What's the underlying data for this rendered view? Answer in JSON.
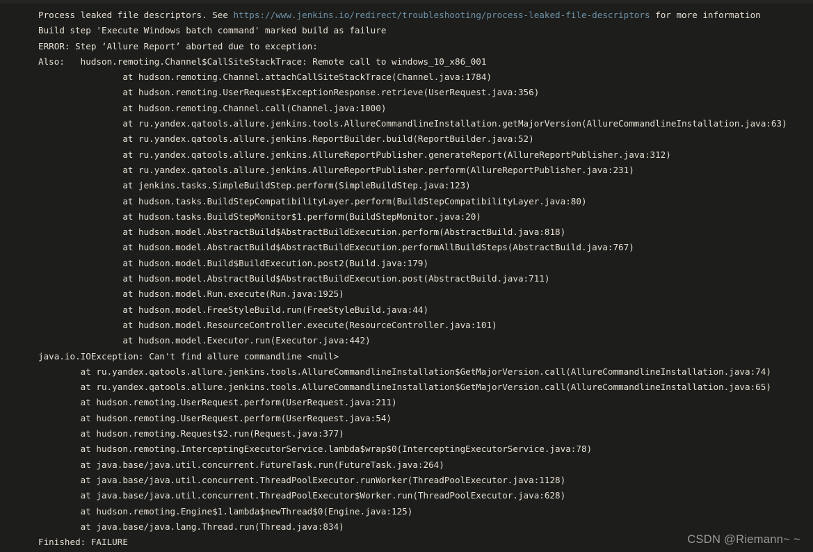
{
  "console": {
    "background_color": "#1d1d1b",
    "text_color": "#e6e0d4",
    "link_color": "#6f93a8",
    "lines": [
      {
        "pre": "Process leaked file descriptors. See ",
        "link": "https://www.jenkins.io/redirect/troubleshooting/process-leaked-file-descriptors",
        "post": " for more information"
      },
      {
        "text": "Build step 'Execute Windows batch command' marked build as failure"
      },
      {
        "text": "ERROR: Step ‘Allure Report’ aborted due to exception:"
      },
      {
        "text": "Also:   hudson.remoting.Channel$CallSiteStackTrace: Remote call to windows_10_x86_001"
      },
      {
        "text": "                at hudson.remoting.Channel.attachCallSiteStackTrace(Channel.java:1784)"
      },
      {
        "text": "                at hudson.remoting.UserRequest$ExceptionResponse.retrieve(UserRequest.java:356)"
      },
      {
        "text": "                at hudson.remoting.Channel.call(Channel.java:1000)"
      },
      {
        "text": "                at ru.yandex.qatools.allure.jenkins.tools.AllureCommandlineInstallation.getMajorVersion(AllureCommandlineInstallation.java:63)"
      },
      {
        "text": "                at ru.yandex.qatools.allure.jenkins.ReportBuilder.build(ReportBuilder.java:52)"
      },
      {
        "text": "                at ru.yandex.qatools.allure.jenkins.AllureReportPublisher.generateReport(AllureReportPublisher.java:312)"
      },
      {
        "text": "                at ru.yandex.qatools.allure.jenkins.AllureReportPublisher.perform(AllureReportPublisher.java:231)"
      },
      {
        "text": "                at jenkins.tasks.SimpleBuildStep.perform(SimpleBuildStep.java:123)"
      },
      {
        "text": "                at hudson.tasks.BuildStepCompatibilityLayer.perform(BuildStepCompatibilityLayer.java:80)"
      },
      {
        "text": "                at hudson.tasks.BuildStepMonitor$1.perform(BuildStepMonitor.java:20)"
      },
      {
        "text": "                at hudson.model.AbstractBuild$AbstractBuildExecution.perform(AbstractBuild.java:818)"
      },
      {
        "text": "                at hudson.model.AbstractBuild$AbstractBuildExecution.performAllBuildSteps(AbstractBuild.java:767)"
      },
      {
        "text": "                at hudson.model.Build$BuildExecution.post2(Build.java:179)"
      },
      {
        "text": "                at hudson.model.AbstractBuild$AbstractBuildExecution.post(AbstractBuild.java:711)"
      },
      {
        "text": "                at hudson.model.Run.execute(Run.java:1925)"
      },
      {
        "text": "                at hudson.model.FreeStyleBuild.run(FreeStyleBuild.java:44)"
      },
      {
        "text": "                at hudson.model.ResourceController.execute(ResourceController.java:101)"
      },
      {
        "text": "                at hudson.model.Executor.run(Executor.java:442)"
      },
      {
        "text": "java.io.IOException: Can't find allure commandline <null>"
      },
      {
        "text": "        at ru.yandex.qatools.allure.jenkins.tools.AllureCommandlineInstallation$GetMajorVersion.call(AllureCommandlineInstallation.java:74)"
      },
      {
        "text": "        at ru.yandex.qatools.allure.jenkins.tools.AllureCommandlineInstallation$GetMajorVersion.call(AllureCommandlineInstallation.java:65)"
      },
      {
        "text": "        at hudson.remoting.UserRequest.perform(UserRequest.java:211)"
      },
      {
        "text": "        at hudson.remoting.UserRequest.perform(UserRequest.java:54)"
      },
      {
        "text": "        at hudson.remoting.Request$2.run(Request.java:377)"
      },
      {
        "text": "        at hudson.remoting.InterceptingExecutorService.lambda$wrap$0(InterceptingExecutorService.java:78)"
      },
      {
        "text": "        at java.base/java.util.concurrent.FutureTask.run(FutureTask.java:264)"
      },
      {
        "text": "        at java.base/java.util.concurrent.ThreadPoolExecutor.runWorker(ThreadPoolExecutor.java:1128)"
      },
      {
        "text": "        at java.base/java.util.concurrent.ThreadPoolExecutor$Worker.run(ThreadPoolExecutor.java:628)"
      },
      {
        "text": "        at hudson.remoting.Engine$1.lambda$newThread$0(Engine.java:125)"
      },
      {
        "text": "        at java.base/java.lang.Thread.run(Thread.java:834)"
      },
      {
        "text": "Finished: FAILURE"
      }
    ]
  },
  "watermark": {
    "text": "CSDN @Riemann~ ~"
  }
}
